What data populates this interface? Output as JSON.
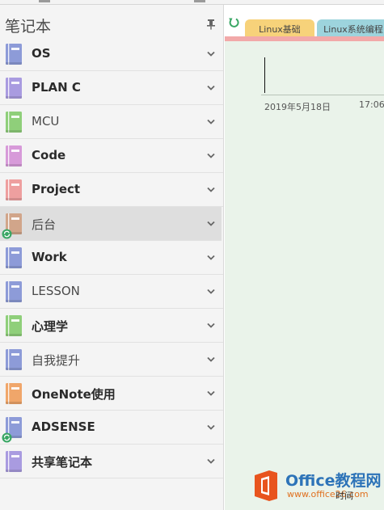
{
  "pane": {
    "title": "笔记本"
  },
  "notebooks": [
    {
      "label": "OS",
      "color": "#8d9bd8",
      "style": "bold",
      "synced": false
    },
    {
      "label": "PLAN C",
      "color": "#a99be0",
      "style": "bold",
      "synced": false
    },
    {
      "label": "MCU",
      "color": "#8fcf7a",
      "style": "normal",
      "synced": false
    },
    {
      "label": "Code",
      "color": "#d79ad9",
      "style": "bold",
      "synced": false
    },
    {
      "label": "Project",
      "color": "#ee9f9f",
      "style": "bold",
      "synced": false
    },
    {
      "label": "后台",
      "color": "#d1a58a",
      "style": "normal",
      "synced": true,
      "selected": true
    },
    {
      "label": "Work",
      "color": "#8d9bd8",
      "style": "bold",
      "synced": false
    },
    {
      "label": "LESSON",
      "color": "#8d9bd8",
      "style": "normal",
      "synced": false
    },
    {
      "label": "心理学",
      "color": "#8fcf7a",
      "style": "bold",
      "synced": false
    },
    {
      "label": "自我提升",
      "color": "#8d9bd8",
      "style": "normal",
      "synced": false
    },
    {
      "label": "OneNote使用",
      "color": "#f0a66a",
      "style": "bold",
      "synced": false
    },
    {
      "label": "ADSENSE",
      "color": "#8d9bd8",
      "style": "bold",
      "synced": true
    },
    {
      "label": "共享笔记本",
      "color": "#a99be0",
      "style": "bold",
      "synced": false
    }
  ],
  "tabs": [
    {
      "label": "Linux基础",
      "color": "#f7d27a"
    },
    {
      "label": "Linux系统编程",
      "color": "#9dd4dd"
    }
  ],
  "page": {
    "date": "2019年5月18日",
    "time": "17:06"
  },
  "watermark": {
    "brand": "Office教程网",
    "url": "www.office26.com",
    "cover_text": "时间"
  },
  "colors": {
    "pane_bg": "#f4f4f4",
    "page_bg": "#eaf3ea",
    "section_underline": "#f2a9a9",
    "sync_icon": "#3aa765"
  }
}
